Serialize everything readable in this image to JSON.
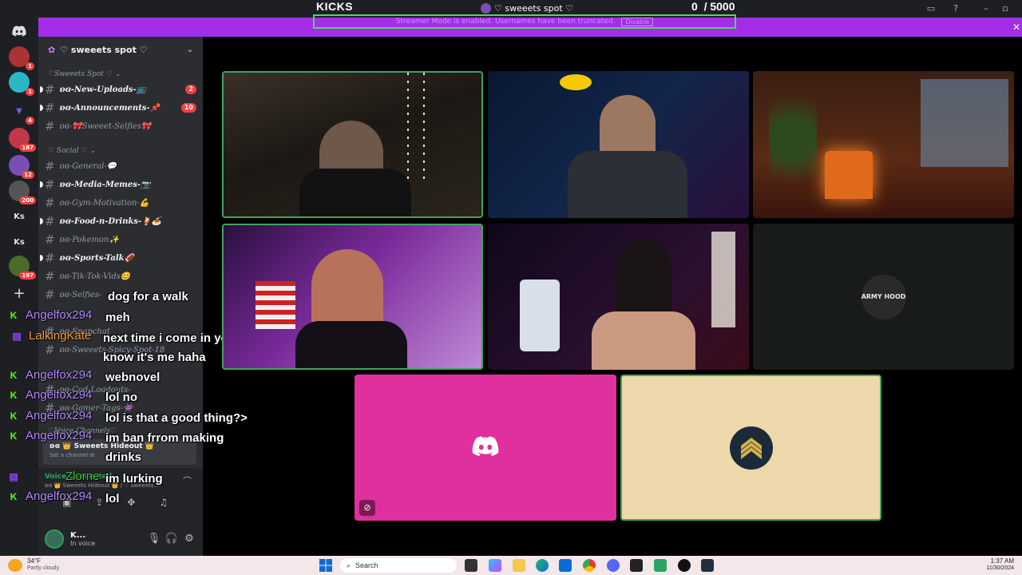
{
  "topbar": {
    "kicks_label": "KICKS",
    "server_name": "♡ sweeets spot ♡",
    "kicks_current": "0",
    "kicks_total": "/ 5000"
  },
  "banner": {
    "text": "Streamer Mode is enabled. Usernames have been truncated.",
    "button": "Disable"
  },
  "rail": {
    "servers": [
      {
        "badge": "1"
      },
      {
        "badge": "1"
      },
      {
        "badge": "4"
      },
      {
        "badge": "187"
      },
      {
        "badge": "12"
      },
      {
        "badge": "200"
      },
      {
        "label": "Ks"
      },
      {
        "label": "Ks"
      },
      {
        "badge": "197"
      }
    ]
  },
  "sidebar": {
    "server_name": "♡ sweeets spot ♡",
    "categories": [
      {
        "label": "♡Sweeets Spot ♡ ⌄"
      },
      {
        "label": "♡ Social ♡ ⌄"
      },
      {
        "label": "♡Voice Channels♡"
      }
    ],
    "channels": [
      {
        "name": "ʚɞ-New-Uploads-📺",
        "count": "2",
        "unread": true
      },
      {
        "name": "ʚɞ-Announcements-📌",
        "count": "10",
        "unread": true
      },
      {
        "name": "ʚɞ-🎀Sweeet-Selfies🎀",
        "count": "",
        "unread": false
      },
      {
        "name": "ʚɞ-General-💬",
        "count": "",
        "unread": false
      },
      {
        "name": "ʚɞ-Media-Memes-📷",
        "count": "",
        "unread": true
      },
      {
        "name": "ʚɞ-Gym-Motivation-💪",
        "count": "",
        "unread": false
      },
      {
        "name": "ʚɞ-Food-n-Drinks-🍹🍝",
        "count": "",
        "unread": true
      },
      {
        "name": "ʚɞ-Pokemon✨",
        "count": "",
        "unread": false
      },
      {
        "name": "ʚɞ-Sports-Talk🏈",
        "count": "",
        "unread": true
      },
      {
        "name": "ʚɞ-Tik-Tok-Vids😊",
        "count": "",
        "unread": false
      },
      {
        "name": "ʚɞ-Selfies-",
        "count": "",
        "unread": false
      },
      {
        "name": "ʚɞ-Snapchat",
        "count": "",
        "unread": false
      },
      {
        "name": "ʚɞ-Sweeets-Spicy-Spot-18",
        "count": "",
        "unread": false
      },
      {
        "name": "ʚɞ-Cod-Loadouts-",
        "count": "",
        "unread": false
      },
      {
        "name": "ʚɞ-Gamer-Tags-👾",
        "count": "",
        "unread": false
      }
    ],
    "voice_channel": {
      "name": "ʚɞ 👑 Sweeets Hideout 👑",
      "sub": "Set a channel st"
    },
    "voice_connected": {
      "title": "Voice Connected",
      "sub": "ʚɞ 👑 Sweeets Hideout 👑 / ♡ sweeets..."
    },
    "user": {
      "name": "K...",
      "status": "In voice"
    }
  },
  "chat": [
    {
      "platform": "none",
      "user": "",
      "color": "#ffffff",
      "message": "dog for a walk"
    },
    {
      "platform": "kick",
      "user": "Angelfox294",
      "color": "#b38bff",
      "message": "meh"
    },
    {
      "platform": "twitch",
      "user": "LalkingKate",
      "color": "#ff9a3c",
      "message": "next time i come in you'll know it's me haha"
    },
    {
      "platform": "kick",
      "user": "Angelfox294",
      "color": "#b38bff",
      "message": "webnovel"
    },
    {
      "platform": "kick",
      "user": "Angelfox294",
      "color": "#b38bff",
      "message": "lol no"
    },
    {
      "platform": "kick",
      "user": "Angelfox294",
      "color": "#b38bff",
      "message": "lol is that a good thing?>"
    },
    {
      "platform": "kick",
      "user": "Angelfox294",
      "color": "#b38bff",
      "message": "im ban frrom making drinks"
    },
    {
      "platform": "twitch",
      "user": "Zlorne",
      "color": "#3fbf3f",
      "message": "im lurking"
    },
    {
      "platform": "kick",
      "user": "Angelfox294",
      "color": "#b38bff",
      "message": "lol"
    }
  ],
  "tiles": [
    {
      "kind": "video",
      "scene": "man with cap, dim bar room with string lights",
      "speaking": true
    },
    {
      "kind": "video",
      "scene": "man with cap and headset, blue neon room",
      "speaking": false
    },
    {
      "kind": "video",
      "scene": "christmas fireplace scene",
      "speaking": false
    },
    {
      "kind": "video",
      "scene": "person with sunglasses and headset, purple lighting",
      "speaking": true
    },
    {
      "kind": "video",
      "scene": "woman with sunglasses, skeleton decor, neon lights",
      "speaking": false
    },
    {
      "kind": "avatar",
      "logo": "ARMY HOOD",
      "speaking": false
    },
    {
      "kind": "avatar",
      "logo": "discord-logo",
      "speaking": false,
      "muted": true
    },
    {
      "kind": "avatar",
      "logo": "sergeant-chevron",
      "speaking": true
    }
  ],
  "colors": {
    "banner": "#a42dea",
    "speaking": "#3ba55c",
    "tile_pink": "#e0309e",
    "tile_tan": "#ecd8ab",
    "tile_dark": "#181c18"
  },
  "taskbar": {
    "weather_temp": "34°F",
    "weather_desc": "Partly cloudy",
    "search": "Search",
    "time": "1:37 AM",
    "date": "11/30/2024"
  }
}
